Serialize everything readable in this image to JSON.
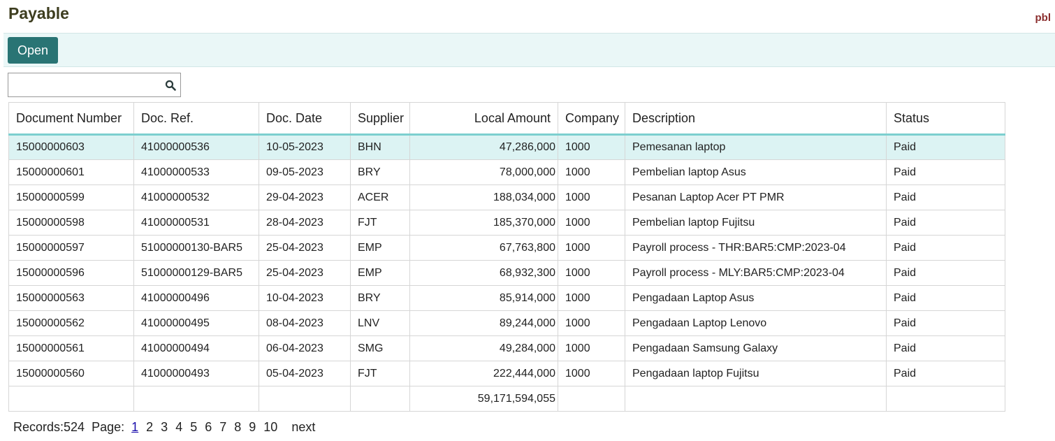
{
  "header": {
    "title": "Payable",
    "app_code": "pbl"
  },
  "toolbar": {
    "open_label": "Open"
  },
  "search": {
    "value": "",
    "placeholder": ""
  },
  "table": {
    "columns": [
      "Document Number",
      "Doc. Ref.",
      "Doc. Date",
      "Supplier",
      "Local Amount",
      "Company",
      "Description",
      "Status"
    ],
    "rows": [
      [
        "15000000603",
        "41000000536",
        "10-05-2023",
        "BHN",
        "47,286,000",
        "1000",
        "Pemesanan laptop",
        "Paid"
      ],
      [
        "15000000601",
        "41000000533",
        "09-05-2023",
        "BRY",
        "78,000,000",
        "1000",
        "Pembelian laptop Asus",
        "Paid"
      ],
      [
        "15000000599",
        "41000000532",
        "29-04-2023",
        "ACER",
        "188,034,000",
        "1000",
        "Pesanan Laptop Acer PT PMR",
        "Paid"
      ],
      [
        "15000000598",
        "41000000531",
        "28-04-2023",
        "FJT",
        "185,370,000",
        "1000",
        "Pembelian laptop Fujitsu",
        "Paid"
      ],
      [
        "15000000597",
        "51000000130-BAR5",
        "25-04-2023",
        "EMP",
        "67,763,800",
        "1000",
        "Payroll process - THR:BAR5:CMP:2023-04",
        "Paid"
      ],
      [
        "15000000596",
        "51000000129-BAR5",
        "25-04-2023",
        "EMP",
        "68,932,300",
        "1000",
        "Payroll process - MLY:BAR5:CMP:2023-04",
        "Paid"
      ],
      [
        "15000000563",
        "41000000496",
        "10-04-2023",
        "BRY",
        "85,914,000",
        "1000",
        "Pengadaan Laptop Asus",
        "Paid"
      ],
      [
        "15000000562",
        "41000000495",
        "08-04-2023",
        "LNV",
        "89,244,000",
        "1000",
        "Pengadaan Laptop Lenovo",
        "Paid"
      ],
      [
        "15000000561",
        "41000000494",
        "06-04-2023",
        "SMG",
        "49,284,000",
        "1000",
        "Pengadaan Samsung Galaxy",
        "Paid"
      ],
      [
        "15000000560",
        "41000000493",
        "05-04-2023",
        "FJT",
        "222,444,000",
        "1000",
        "Pengadaan laptop Fujitsu",
        "Paid"
      ]
    ],
    "total_amount": "59,171,594,055"
  },
  "pager": {
    "records_label": "Records:524",
    "page_label": "Page:",
    "pages": [
      "1",
      "2",
      "3",
      "4",
      "5",
      "6",
      "7",
      "8",
      "9",
      "10"
    ],
    "current_page": "1",
    "next_label": "next"
  },
  "colors": {
    "accent": "#297474",
    "toolbar_bg": "#eaf7f7",
    "selected_row": "#dcf3f3",
    "header_underline": "#7ccfcf",
    "app_code": "#8b2e2e"
  },
  "icons": {
    "search": "search-icon"
  }
}
